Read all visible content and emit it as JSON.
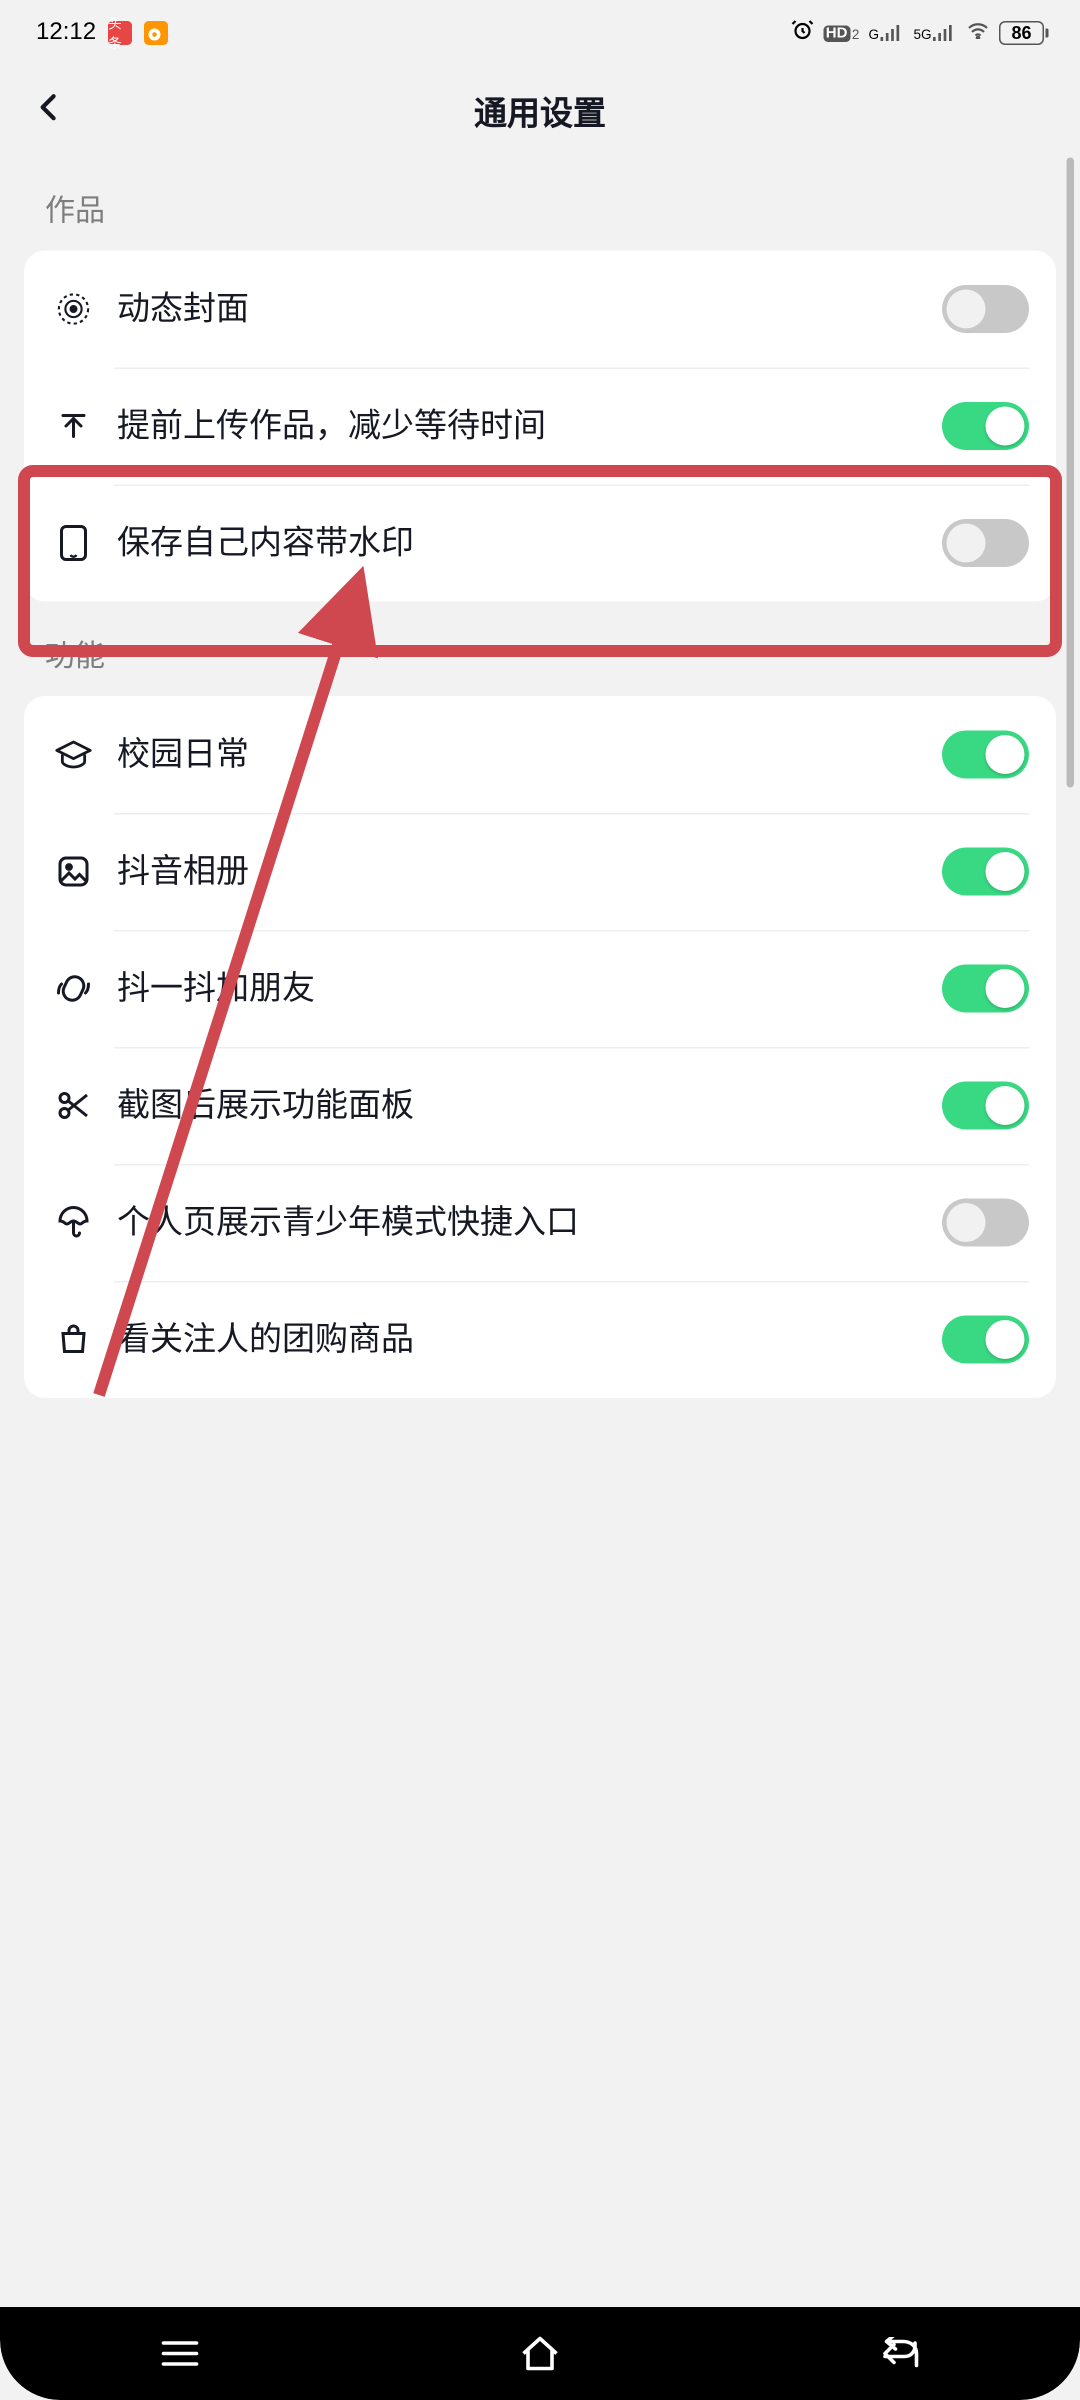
{
  "status": {
    "time": "12:12",
    "battery": "86",
    "signal_label_g": "G",
    "signal_label_5g": "5G",
    "hd_label": "HD",
    "hd_sub": "2"
  },
  "header": {
    "title": "通用设置"
  },
  "sections": [
    {
      "title": "作品",
      "items": [
        {
          "id": "dynamic-cover",
          "label": "动态封面",
          "on": false,
          "icon": "target"
        },
        {
          "id": "pre-upload",
          "label": "提前上传作品，减少等待时间",
          "on": true,
          "icon": "upload"
        },
        {
          "id": "save-watermark",
          "label": "保存自己内容带水印",
          "on": false,
          "icon": "phone"
        }
      ]
    },
    {
      "title": "功能",
      "items": [
        {
          "id": "campus",
          "label": "校园日常",
          "on": true,
          "icon": "graduation"
        },
        {
          "id": "album",
          "label": "抖音相册",
          "on": true,
          "icon": "image"
        },
        {
          "id": "shake-friend",
          "label": "抖一抖加朋友",
          "on": true,
          "icon": "shake"
        },
        {
          "id": "screenshot-panel",
          "label": "截图后展示功能面板",
          "on": true,
          "icon": "scissors"
        },
        {
          "id": "teen-shortcut",
          "label": "个人页展示青少年模式快捷入口",
          "on": false,
          "icon": "umbrella"
        },
        {
          "id": "follow-groupbuy",
          "label": "看关注人的团购商品",
          "on": true,
          "icon": "bag"
        }
      ]
    }
  ],
  "annotation": {
    "highlight_target": "save-watermark",
    "arrow_color": "#d0484f"
  }
}
